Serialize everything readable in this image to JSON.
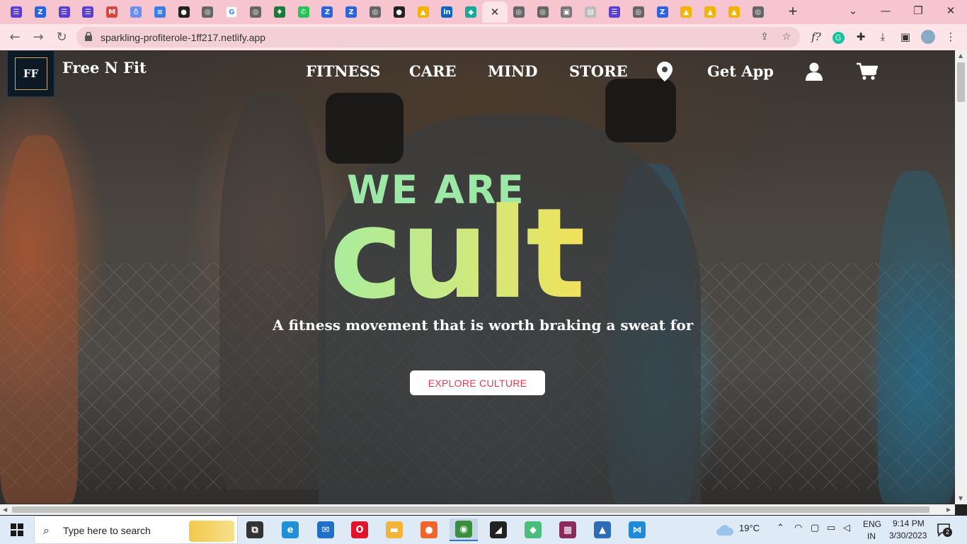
{
  "browser": {
    "tabs": [
      {
        "icon": "sheets-icon",
        "color": "#5b3fd0",
        "glyph": "☰"
      },
      {
        "icon": "zoho-icon",
        "color": "#2a64e0",
        "glyph": "Z"
      },
      {
        "icon": "sheets-icon",
        "color": "#5b3fd0",
        "glyph": "☰"
      },
      {
        "icon": "sheets-icon",
        "color": "#5b3fd0",
        "glyph": "☰"
      },
      {
        "icon": "gmail-icon",
        "color": "#d9463d",
        "glyph": "M"
      },
      {
        "icon": "hand-icon",
        "color": "#6a8ff0",
        "glyph": "♁"
      },
      {
        "icon": "docs-icon",
        "color": "#3b7de8",
        "glyph": "≡"
      },
      {
        "icon": "github-icon",
        "color": "#222222",
        "glyph": "●"
      },
      {
        "icon": "globe-icon",
        "color": "#666666",
        "glyph": "◎"
      },
      {
        "icon": "google-icon",
        "color": "#ffffff",
        "glyph": "G"
      },
      {
        "icon": "globe-icon",
        "color": "#666666",
        "glyph": "◎"
      },
      {
        "icon": "leaf-icon",
        "color": "#1d7a3a",
        "glyph": "♦"
      },
      {
        "icon": "whatsapp-icon",
        "color": "#25c258",
        "glyph": "✆"
      },
      {
        "icon": "zoho-icon",
        "color": "#2a64e0",
        "glyph": "Z"
      },
      {
        "icon": "zoho-icon",
        "color": "#2a64e0",
        "glyph": "Z"
      },
      {
        "icon": "globe-icon",
        "color": "#666666",
        "glyph": "◎"
      },
      {
        "icon": "github-icon",
        "color": "#222222",
        "glyph": "●"
      },
      {
        "icon": "drive-icon",
        "color": "#f2b400",
        "glyph": "▲"
      },
      {
        "icon": "linkedin-icon",
        "color": "#0a66c2",
        "glyph": "in"
      },
      {
        "icon": "diamond-icon",
        "color": "#18a89a",
        "glyph": "◆"
      },
      {
        "icon": "close-icon",
        "color": "#fde4e9",
        "glyph": "✕",
        "active": true
      },
      {
        "icon": "globe-icon",
        "color": "#666666",
        "glyph": "◎"
      },
      {
        "icon": "globe-icon",
        "color": "#666666",
        "glyph": "◎"
      },
      {
        "icon": "image-icon",
        "color": "#777777",
        "glyph": "▣"
      },
      {
        "icon": "doc-icon",
        "color": "#bbbbbb",
        "glyph": "▤"
      },
      {
        "icon": "sheets-icon",
        "color": "#5b3fd0",
        "glyph": "☰"
      },
      {
        "icon": "globe-icon",
        "color": "#666666",
        "glyph": "◎"
      },
      {
        "icon": "zoho-icon",
        "color": "#2a64e0",
        "glyph": "Z"
      },
      {
        "icon": "drive-icon",
        "color": "#f2b400",
        "glyph": "▲"
      },
      {
        "icon": "drive-icon",
        "color": "#f2b400",
        "glyph": "▲"
      },
      {
        "icon": "drive-icon",
        "color": "#f2b400",
        "glyph": "▲"
      },
      {
        "icon": "globe-icon",
        "color": "#666666",
        "glyph": "◎"
      }
    ],
    "new_tab": "+",
    "url": "sparkling-profiterole-1ff217.netlify.app"
  },
  "site": {
    "logo_text": "FF",
    "name": "Free N Fit",
    "nav": [
      "FITNESS",
      "CARE",
      "MIND",
      "STORE"
    ],
    "get_app": "Get App"
  },
  "hero": {
    "headline_top": "WE ARE",
    "headline_main": "cult",
    "tagline": "A fitness movement that is worth braking a sweat for",
    "cta": "EXPLORE CULTURE",
    "cta_color": "#e03a4f"
  },
  "taskbar": {
    "search_placeholder": "Type here to search",
    "apps": [
      {
        "icon": "task-view-icon",
        "color": "#333333",
        "glyph": "⧉"
      },
      {
        "icon": "edge-icon",
        "color": "#1f8fd6",
        "glyph": "e"
      },
      {
        "icon": "mail-icon",
        "color": "#1f6fc8",
        "glyph": "✉"
      },
      {
        "icon": "opera-icon",
        "color": "#e0142c",
        "glyph": "O"
      },
      {
        "icon": "file-explorer-icon",
        "color": "#f2b53a",
        "glyph": "▬"
      },
      {
        "icon": "firefox-icon",
        "color": "#f0662a",
        "glyph": "●"
      },
      {
        "icon": "chrome-icon",
        "color": "#3a8f3d",
        "glyph": "◉",
        "active": true
      },
      {
        "icon": "sticky-notes-icon",
        "color": "#222222",
        "glyph": "◢"
      },
      {
        "icon": "paint-icon",
        "color": "#4bbd7a",
        "glyph": "◆"
      },
      {
        "icon": "winrar-icon",
        "color": "#8a2b5c",
        "glyph": "▦"
      },
      {
        "icon": "photos-icon",
        "color": "#2d6db8",
        "glyph": "▲"
      },
      {
        "icon": "vscode-icon",
        "color": "#1f8ad8",
        "glyph": "⋈"
      }
    ],
    "weather": "19°C",
    "language": "ENG",
    "region": "IN",
    "time": "9:14 PM",
    "date": "3/30/2023",
    "notifications": "2"
  }
}
